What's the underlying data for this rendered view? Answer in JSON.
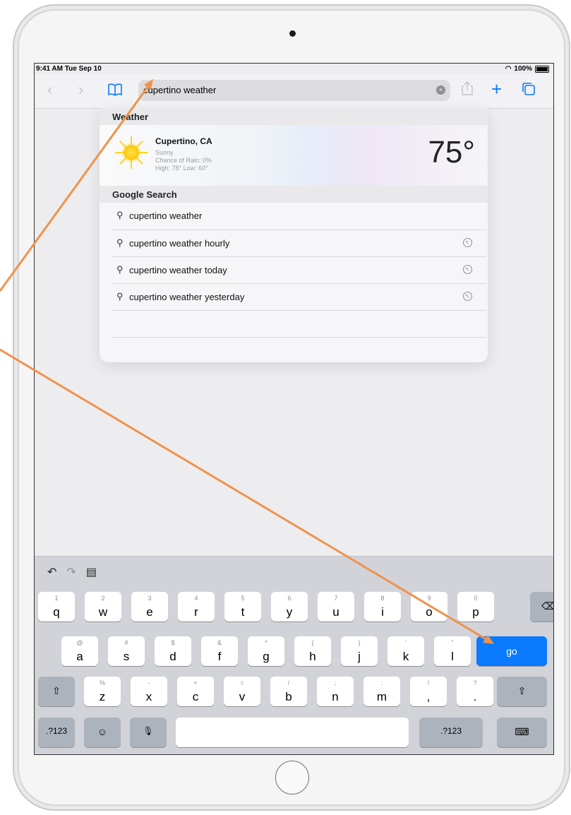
{
  "status": {
    "time": "9:41 AM  Tue Sep 10",
    "battery": "100%"
  },
  "toolbar": {
    "back_icon": "‹",
    "forward_icon": "›",
    "bookmarks_icon": "book-icon",
    "share_icon": "share-icon",
    "add_icon": "+",
    "tabs_icon": "tabs-icon"
  },
  "search": {
    "value": "cupertino weather",
    "clear_icon": "×"
  },
  "weather": {
    "section": "Weather",
    "city": "Cupertino, CA",
    "condition": "Sunny",
    "rain": "Chance of Rain: 0%",
    "highlow": "High: 78° Low: 60°",
    "temp": "75°"
  },
  "google": {
    "section": "Google Search",
    "suggestions": [
      {
        "text": "cupertino weather"
      },
      {
        "text": "cupertino weather hourly"
      },
      {
        "text": "cupertino weather today"
      },
      {
        "text": "cupertino weather yesterday"
      }
    ]
  },
  "keyboard": {
    "row1": [
      [
        "1",
        "q"
      ],
      [
        "2",
        "w"
      ],
      [
        "3",
        "e"
      ],
      [
        "4",
        "r"
      ],
      [
        "5",
        "t"
      ],
      [
        "6",
        "y"
      ],
      [
        "7",
        "u"
      ],
      [
        "8",
        "i"
      ],
      [
        "9",
        "o"
      ],
      [
        "0",
        "p"
      ]
    ],
    "row2": [
      [
        "@",
        "a"
      ],
      [
        "#",
        "s"
      ],
      [
        "$",
        "d"
      ],
      [
        "&",
        "f"
      ],
      [
        "*",
        "g"
      ],
      [
        "(",
        "h"
      ],
      [
        ")",
        "j"
      ],
      [
        "’",
        "k"
      ],
      [
        "”",
        "l"
      ]
    ],
    "row3": [
      [
        "%",
        "z"
      ],
      [
        "-",
        "x"
      ],
      [
        "+",
        "c"
      ],
      [
        "=",
        "v"
      ],
      [
        "/",
        "b"
      ],
      [
        ";",
        "n"
      ],
      [
        ":",
        "m"
      ],
      [
        "!",
        ","
      ],
      [
        "?",
        "."
      ]
    ],
    "go": "go",
    "numbers": ".?123",
    "delete_icon": "⌫",
    "shift_icon": "⇧",
    "emoji_icon": "☺",
    "mic_icon": "🎙",
    "dismiss_icon": "⌨"
  },
  "colors": {
    "accent": "#0a7aff",
    "annotation": "#f0924a"
  }
}
